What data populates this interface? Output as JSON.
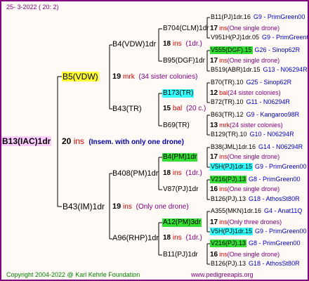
{
  "header": {
    "date": "25-  3-2022 ( 20:  2)"
  },
  "footer": {
    "copyright": "Copyright 2004-2022 @ Karl Kehrle Foundation",
    "site": "www.pedigreeapis.org"
  },
  "colors": {
    "border": "#800080",
    "line": "#000000",
    "yellow": "#ffff33",
    "green": "#33dd33",
    "cyan": "#33ffff",
    "pink": "#ffccff"
  },
  "root": {
    "name": "B13(IAC)1dr",
    "num": "20",
    "unit": "ins",
    "note": "(Insem. with only one drone)"
  },
  "sire_mother": {
    "name": "B5(VDW)",
    "num": "19",
    "unit": "mrk",
    "note": "(34 sister colonies)"
  },
  "sire_father": {
    "name": "B43(IM)1dr",
    "num": "19",
    "unit": "ins",
    "note": "(Only one drone)"
  },
  "gen3": [
    {
      "name": "B4(VDW)1dr",
      "num": "18",
      "unit": "ins",
      "note": "(1dr.)"
    },
    {
      "name": "B43(TR)",
      "num": "15",
      "unit": "bal",
      "note": "(20 c.)"
    },
    {
      "name": "B408(PM)1dr",
      "num": "18",
      "unit": "ins",
      "note": "(1dr.)"
    },
    {
      "name": "A96(RHP)1dr",
      "num": "18",
      "unit": "ins",
      "note": "(1dr.)"
    }
  ],
  "gen4": [
    {
      "name": "B704(CLM)1dr"
    },
    {
      "name": "B95(DGF)1dr"
    },
    {
      "name": "B173(TR)"
    },
    {
      "name": "B69(TR)"
    },
    {
      "name": "B4(PM)1dr"
    },
    {
      "name": "V87(PJ)1dr"
    },
    {
      "name": "A12(PM)3dr"
    },
    {
      "name": "B11(PJ)1dr"
    }
  ],
  "gen5": [
    {
      "name": "B11(PJ)1dr.16",
      "code": "G9 - PrimGreen00"
    },
    {
      "num": "17",
      "unit": "ins",
      "note": "(One single drone)"
    },
    {
      "name": "V951H(PJ)1dr.05",
      "code": "G9 - PrimGreen00"
    },
    {
      "name": "V555(DGF).15",
      "code": "G26 - Sinop62R"
    },
    {
      "num": "17",
      "unit": "ins",
      "note": "(One single drone)"
    },
    {
      "name": "B519(ABR)1dr.15",
      "code": "G13 - N06294R"
    },
    {
      "name": "B70(TR).10",
      "code": "G25 - Sinop62R"
    },
    {
      "num": "12",
      "unit": "bal",
      "note": "(24 sister colonies)"
    },
    {
      "name": "B72(TR).10",
      "code": "G11 - N06294R"
    },
    {
      "name": "B63(TR).12",
      "code": "G9 - Kangaroo98R"
    },
    {
      "num": "13",
      "unit": "mrk",
      "note": "(24 sister colonies)"
    },
    {
      "name": "B129(TR).10",
      "code": "G10 - N06294R"
    },
    {
      "name": "B38(JML)1dr.16",
      "code": "G14 - N06294R"
    },
    {
      "num": "17",
      "unit": "ins",
      "note": "(One single drone)"
    },
    {
      "name": "V5H(PJ)1dr.15",
      "code": "G9 - PrimGreen00"
    },
    {
      "name": "V216(PJ).13",
      "code": "G8 - PrimGreen00"
    },
    {
      "num": "16",
      "unit": "ins",
      "note": "(One single drone)"
    },
    {
      "name": "B126(PJ).13",
      "code": "G18 - AthosSt80R"
    },
    {
      "name": "A355(MKN)1dr.16",
      "code": "G4 - Anat11Q"
    },
    {
      "num": "17",
      "unit": "ins",
      "note": "(Only three drones)"
    },
    {
      "name": "V5H(PJ)1dr.15",
      "code": "G9 - PrimGreen00"
    },
    {
      "name": "V216(PJ).13",
      "code": "G8 - PrimGreen00"
    },
    {
      "num": "16",
      "unit": "ins",
      "note": "(One single drone)"
    },
    {
      "name": "B126(PJ).13",
      "code": "G18 - AthosSt80R"
    }
  ]
}
